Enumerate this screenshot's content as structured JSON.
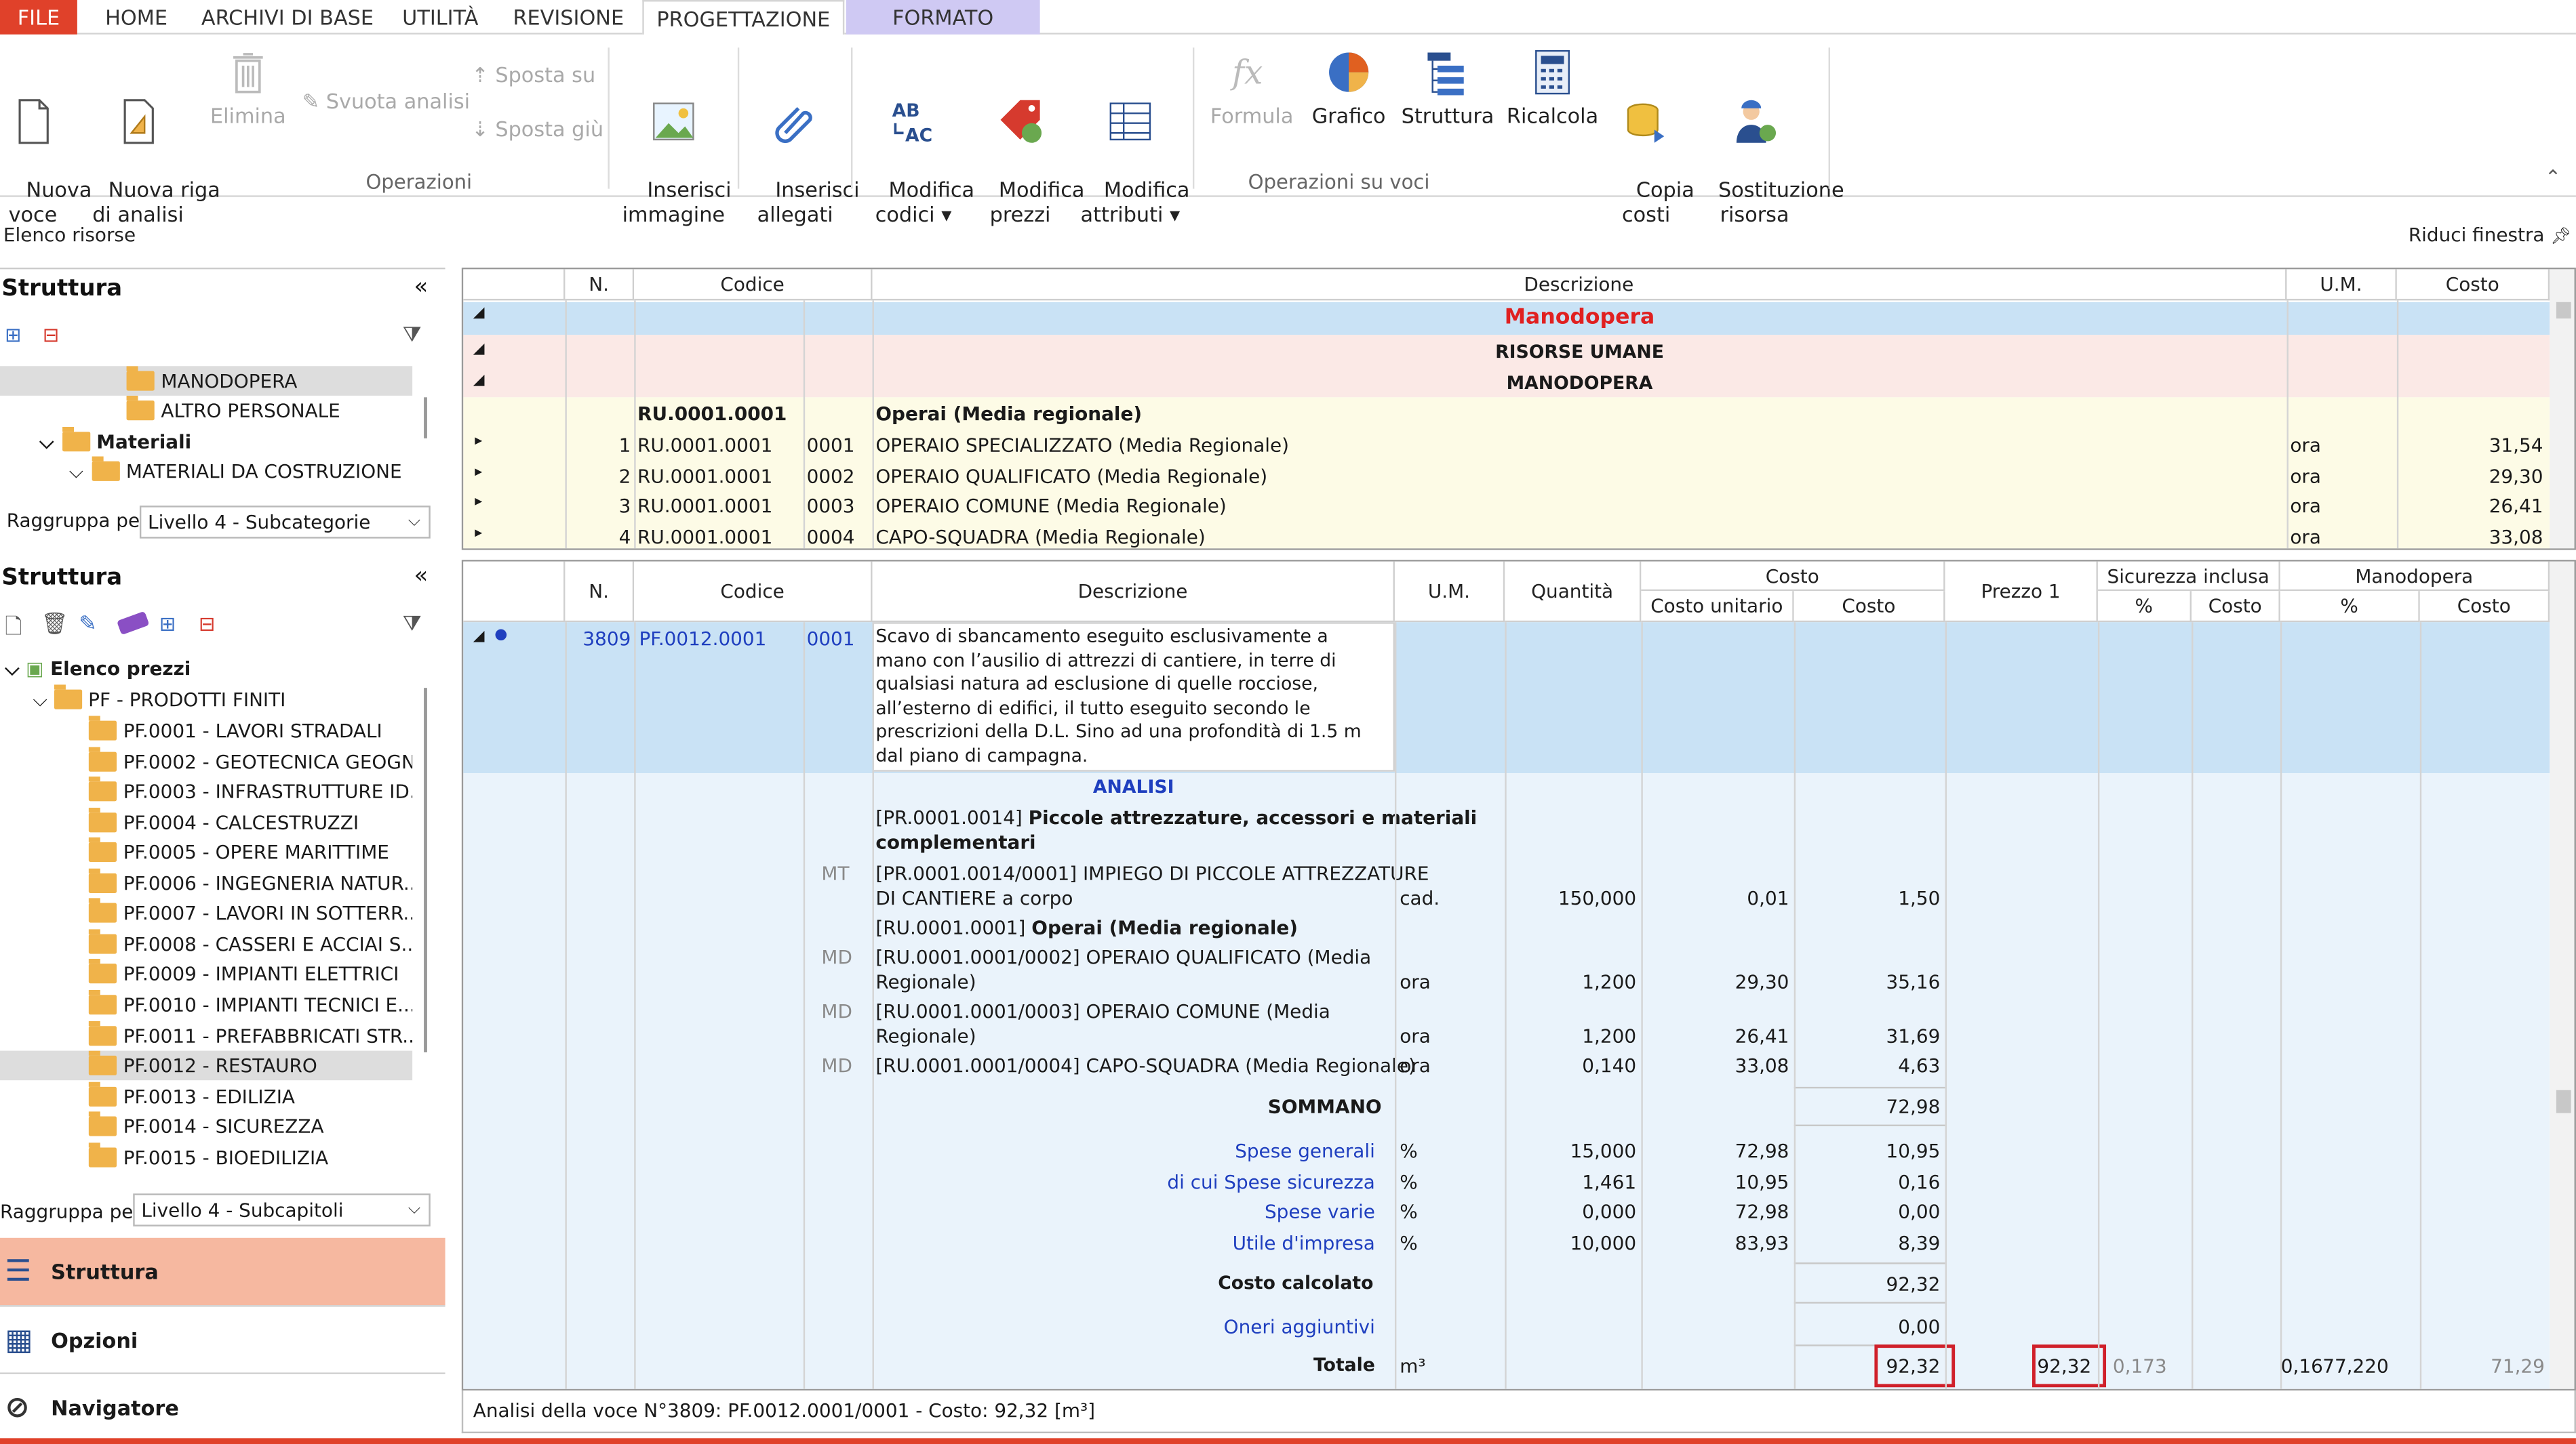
{
  "tabs": [
    "FILE",
    "HOME",
    "ARCHIVI DI BASE",
    "UTILITÀ",
    "REVISIONE",
    "PROGETTAZIONE",
    "FORMATO"
  ],
  "ribbon": {
    "nuova_voce": "Nuova\nvoce",
    "nuova_riga": "Nuova riga\ndi analisi",
    "elimina": "Elimina",
    "svuota": "Svuota analisi",
    "sposta_su": "Sposta su",
    "sposta_giu": "Sposta giù",
    "inserisci_immagine": "Inserisci\nimmagine",
    "inserisci_allegati": "Inserisci\nallegati",
    "modifica_codici": "Modifica\ncodici ▾",
    "modifica_prezzi": "Modifica\nprezzi",
    "modifica_attributi": "Modifica\nattributi ▾",
    "formula": "Formula",
    "grafico": "Grafico",
    "struttura": "Struttura",
    "ricalcola": "Ricalcola",
    "copia_costi": "Copia\ncosti",
    "sostituzione": "Sostituzione\nrisorsa",
    "group_operazioni": "Operazioni",
    "group_operazioni_voci": "Operazioni su voci"
  },
  "bar": {
    "elenco_risorse": "Elenco risorse",
    "riduci": "Riduci finestra"
  },
  "top_panel": {
    "title": "Struttura",
    "tree": [
      "MANODOPERA",
      "ALTRO PERSONALE",
      "Materiali",
      "MATERIALI DA COSTRUZIONE"
    ],
    "group_label": "Raggruppa per",
    "group_value": "Livello 4 - Subcategorie"
  },
  "top_grid": {
    "headers": {
      "n": "N.",
      "codice": "Codice",
      "descrizione": "Descrizione",
      "um": "U.M.",
      "costo": "Costo"
    },
    "group1": "Manodopera",
    "group2": "RISORSE UMANE",
    "group3": "MANODOPERA",
    "sub": {
      "code": "RU.0001.0001",
      "desc": "Operai (Media regionale)"
    },
    "rows": [
      {
        "n": "1",
        "code": "RU.0001.0001",
        "sub": "0001",
        "desc": "OPERAIO SPECIALIZZATO (Media Regionale)",
        "um": "ora",
        "costo": "31,54"
      },
      {
        "n": "2",
        "code": "RU.0001.0001",
        "sub": "0002",
        "desc": "OPERAIO QUALIFICATO (Media Regionale)",
        "um": "ora",
        "costo": "29,30"
      },
      {
        "n": "3",
        "code": "RU.0001.0001",
        "sub": "0003",
        "desc": "OPERAIO COMUNE (Media Regionale)",
        "um": "ora",
        "costo": "26,41"
      },
      {
        "n": "4",
        "code": "RU.0001.0001",
        "sub": "0004",
        "desc": "CAPO-SQUADRA (Media Regionale)",
        "um": "ora",
        "costo": "33,08"
      }
    ]
  },
  "bottom_panel": {
    "title": "Struttura",
    "root": "Elenco prezzi",
    "pf": "PF - PRODOTTI FINITI",
    "items": [
      "PF.0001 - LAVORI STRADALI",
      "PF.0002 - GEOTECNICA GEOGN...",
      "PF.0003 - INFRASTRUTTURE ID...",
      "PF.0004 - CALCESTRUZZI",
      "PF.0005 - OPERE MARITTIME",
      "PF.0006 - INGEGNERIA NATUR...",
      "PF.0007 - LAVORI IN SOTTERR...",
      "PF.0008 - CASSERI E ACCIAI S...",
      "PF.0009 - IMPIANTI ELETTRICI",
      "PF.0010 - IMPIANTI TECNICI E...",
      "PF.0011 - PREFABBRICATI STR...",
      "PF.0012 - RESTAURO",
      "PF.0013 - EDILIZIA",
      "PF.0014 - SICUREZZA",
      "PF.0015 - BIOEDILIZIA"
    ],
    "group_label": "Raggruppa per",
    "group_value": "Livello 4 - Subcapitoli"
  },
  "nav": {
    "struttura": "Struttura",
    "opzioni": "Opzioni",
    "navigatore": "Navigatore"
  },
  "main_grid": {
    "headers": {
      "n": "N.",
      "codice": "Codice",
      "descrizione": "Descrizione",
      "um": "U.M.",
      "quantita": "Quantità",
      "costo": "Costo",
      "costo_unitario": "Costo unitario",
      "costo_c": "Costo",
      "prezzo1": "Prezzo 1",
      "sicurezza": "Sicurezza inclusa",
      "pct": "%",
      "sic_costo": "Costo",
      "manodopera": "Manodopera",
      "pct2": "%",
      "mano_costo": "Costo"
    },
    "voce": {
      "n": "3809",
      "code": "PF.0012.0001",
      "sub": "0001",
      "desc": [
        "Scavo di sbancamento eseguito esclusivamente a",
        "mano con l’ausilio di attrezzi di cantiere, in terre di",
        "qualsiasi natura ad esclusione di quelle rocciose,",
        "all’esterno di edifici, il tutto eseguito secondo le",
        "prescrizioni della D.L. Sino ad una profondità di 1.5 m",
        "dal piano di campagna."
      ]
    },
    "analisi": "ANALISI",
    "pr_group": {
      "code": "[PR.0001.0014]",
      "desc": "Piccole attrezzature, accessori e materiali",
      "desc2": "complementari"
    },
    "mt": {
      "tag": "MT",
      "desc1": "[PR.0001.0014/0001] IMPIEGO DI PICCOLE ATTREZZATURE",
      "desc2": "DI CANTIERE a corpo",
      "um": "cad.",
      "qta": "150,000",
      "cu": "0,01",
      "costo": "1,50"
    },
    "ru_group": {
      "code": "[RU.0001.0001]",
      "desc": "Operai (Media regionale)"
    },
    "md": [
      {
        "tag": "MD",
        "desc1": "[RU.0001.0001/0002] OPERAIO QUALIFICATO (Media",
        "desc2": "Regionale)",
        "um": "ora",
        "qta": "1,200",
        "cu": "29,30",
        "costo": "35,16"
      },
      {
        "tag": "MD",
        "desc1": "[RU.0001.0001/0003] OPERAIO COMUNE (Media",
        "desc2": "Regionale)",
        "um": "ora",
        "qta": "1,200",
        "cu": "26,41",
        "costo": "31,69"
      },
      {
        "tag": "MD",
        "desc1": "[RU.0001.0001/0004] CAPO-SQUADRA (Media Regionale)",
        "desc2": "",
        "um": "ora",
        "qta": "0,140",
        "cu": "33,08",
        "costo": "4,63"
      }
    ],
    "sommano": {
      "label": "SOMMANO",
      "costo": "72,98"
    },
    "spese": [
      {
        "label": "Spese generali",
        "um": "%",
        "qta": "15,000",
        "cu": "72,98",
        "costo": "10,95"
      },
      {
        "label": "di cui Spese sicurezza",
        "um": "%",
        "qta": "1,461",
        "cu": "10,95",
        "costo": "0,16"
      },
      {
        "label": "Spese varie",
        "um": "%",
        "qta": "0,000",
        "cu": "72,98",
        "costo": "0,00"
      },
      {
        "label": "Utile d'impresa",
        "um": "%",
        "qta": "10,000",
        "cu": "83,93",
        "costo": "8,39"
      }
    ],
    "costo_calcolato": {
      "label": "Costo calcolato",
      "costo": "92,32"
    },
    "oneri": {
      "label": "Oneri aggiuntivi",
      "costo": "0,00"
    },
    "totale": {
      "label": "Totale",
      "um": "m³",
      "costo": "92,32",
      "prezzo": "92,32",
      "sic_pct": "0,173",
      "sic_costo": "0,16",
      "mano_pct": "77,220",
      "mano_costo": "71,29"
    }
  },
  "status": "Analisi della voce N°3809: PF.0012.0001/0001 - Costo: 92,32 [m³]"
}
